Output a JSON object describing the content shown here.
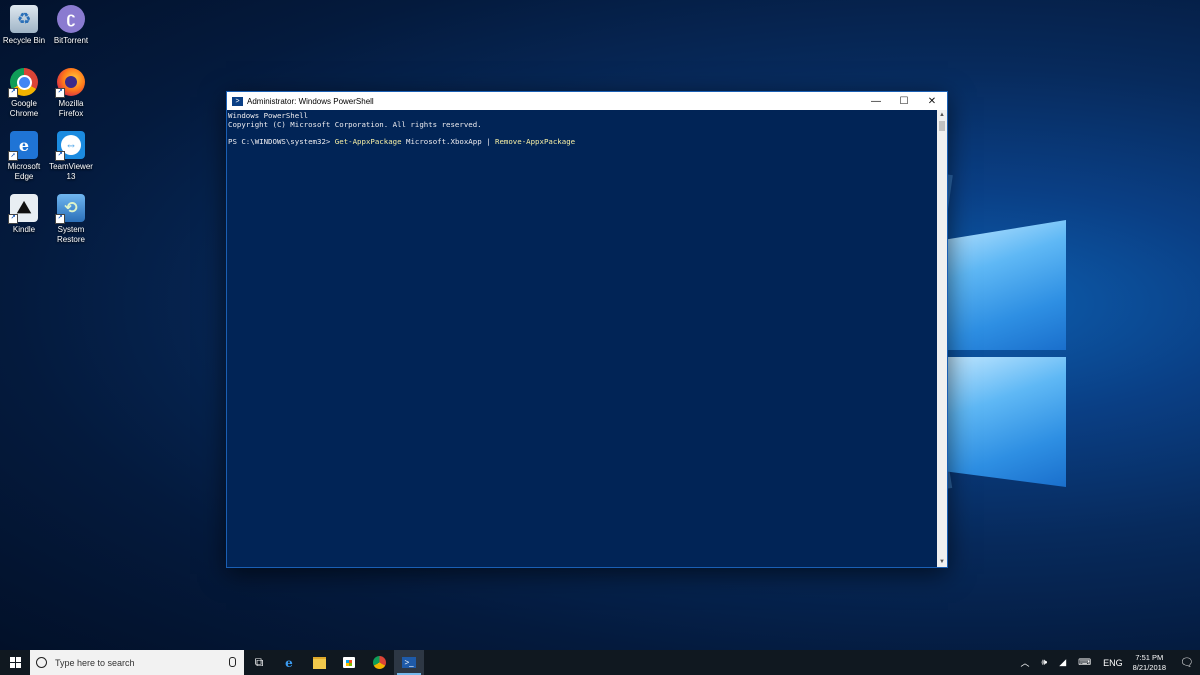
{
  "desktop": {
    "icons": [
      {
        "label": "Recycle Bin",
        "icon": "recycle-bin-icon"
      },
      {
        "label": "BitTorrent",
        "icon": "bittorrent-icon"
      },
      {
        "label": "Google Chrome",
        "icon": "chrome-icon"
      },
      {
        "label": "Mozilla Firefox",
        "icon": "firefox-icon"
      },
      {
        "label": "Microsoft Edge",
        "icon": "edge-icon"
      },
      {
        "label": "TeamViewer 13",
        "icon": "teamviewer-icon"
      },
      {
        "label": "Kindle",
        "icon": "kindle-icon"
      },
      {
        "label": "System Restore",
        "icon": "system-restore-icon"
      }
    ]
  },
  "window": {
    "title": "Administrator: Windows PowerShell",
    "minimize": "—",
    "maximize": "☐",
    "close": "✕",
    "console": {
      "line1": "Windows PowerShell",
      "line2": "Copyright (C) Microsoft Corporation. All rights reserved.",
      "prompt": "PS C:\\WINDOWS\\system32> ",
      "cmd1": "Get-AppxPackage",
      "arg1": " Microsoft.XboxApp | ",
      "cmd2": "Remove-AppxPackage"
    }
  },
  "taskbar": {
    "search_placeholder": "Type here to search",
    "pinned": [
      "task-view-icon",
      "edge-icon",
      "file-explorer-icon",
      "store-icon",
      "chrome-icon",
      "powershell-icon"
    ],
    "tray": {
      "language": "ENG",
      "time": "7:51 PM",
      "date": "8/21/2018"
    }
  },
  "colors": {
    "console_bg": "#012456",
    "console_fg": "#eeedf0",
    "command_yellow": "#f9f1a5",
    "taskbar_bg": "#101820"
  }
}
